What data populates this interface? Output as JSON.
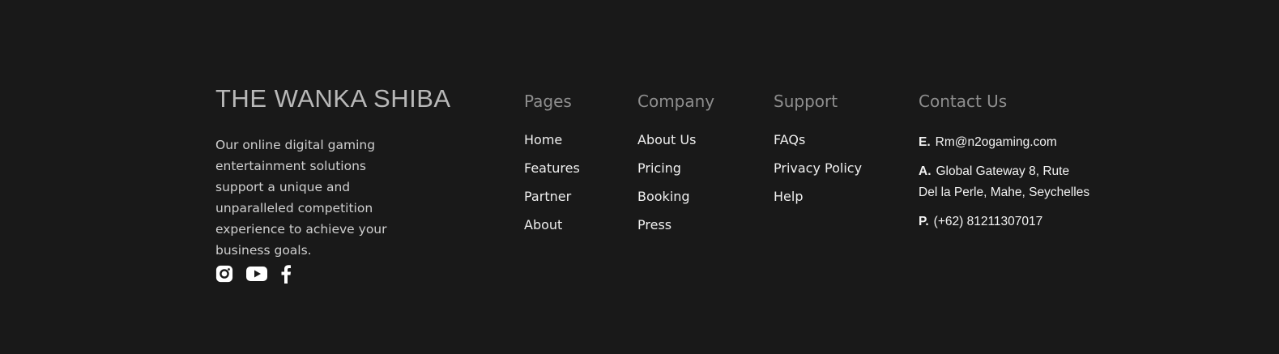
{
  "brand": {
    "name": "THE WANKA SHIBA",
    "description": "Our online digital gaming entertainment solutions support a unique and unparalleled competition experience to achieve your business goals."
  },
  "social": {
    "icons": [
      "instagram-icon",
      "youtube-icon",
      "facebook-icon"
    ],
    "color": "#ffffff"
  },
  "columns": {
    "pages": {
      "title": "Pages",
      "links": [
        "Home",
        "Features",
        "Partner",
        "About"
      ]
    },
    "company": {
      "title": "Company",
      "links": [
        "About Us",
        "Pricing",
        "Booking",
        "Press"
      ]
    },
    "support": {
      "title": "Support",
      "links": [
        "FAQs",
        "Privacy Policy",
        "Help"
      ]
    },
    "contact": {
      "title": "Contact Us",
      "email_prefix": "E.",
      "email": "Rm@n2ogaming.com",
      "address_prefix": "A.",
      "address_line1": "Global Gateway 8, Rute",
      "address_line2": "Del la Perle, Mahe, Seychelles",
      "phone_prefix": "P.",
      "phone": "(+62) 81211307017"
    }
  },
  "colors": {
    "background": "#191919",
    "heading": "#8e8e8e",
    "text": "#efefef"
  }
}
